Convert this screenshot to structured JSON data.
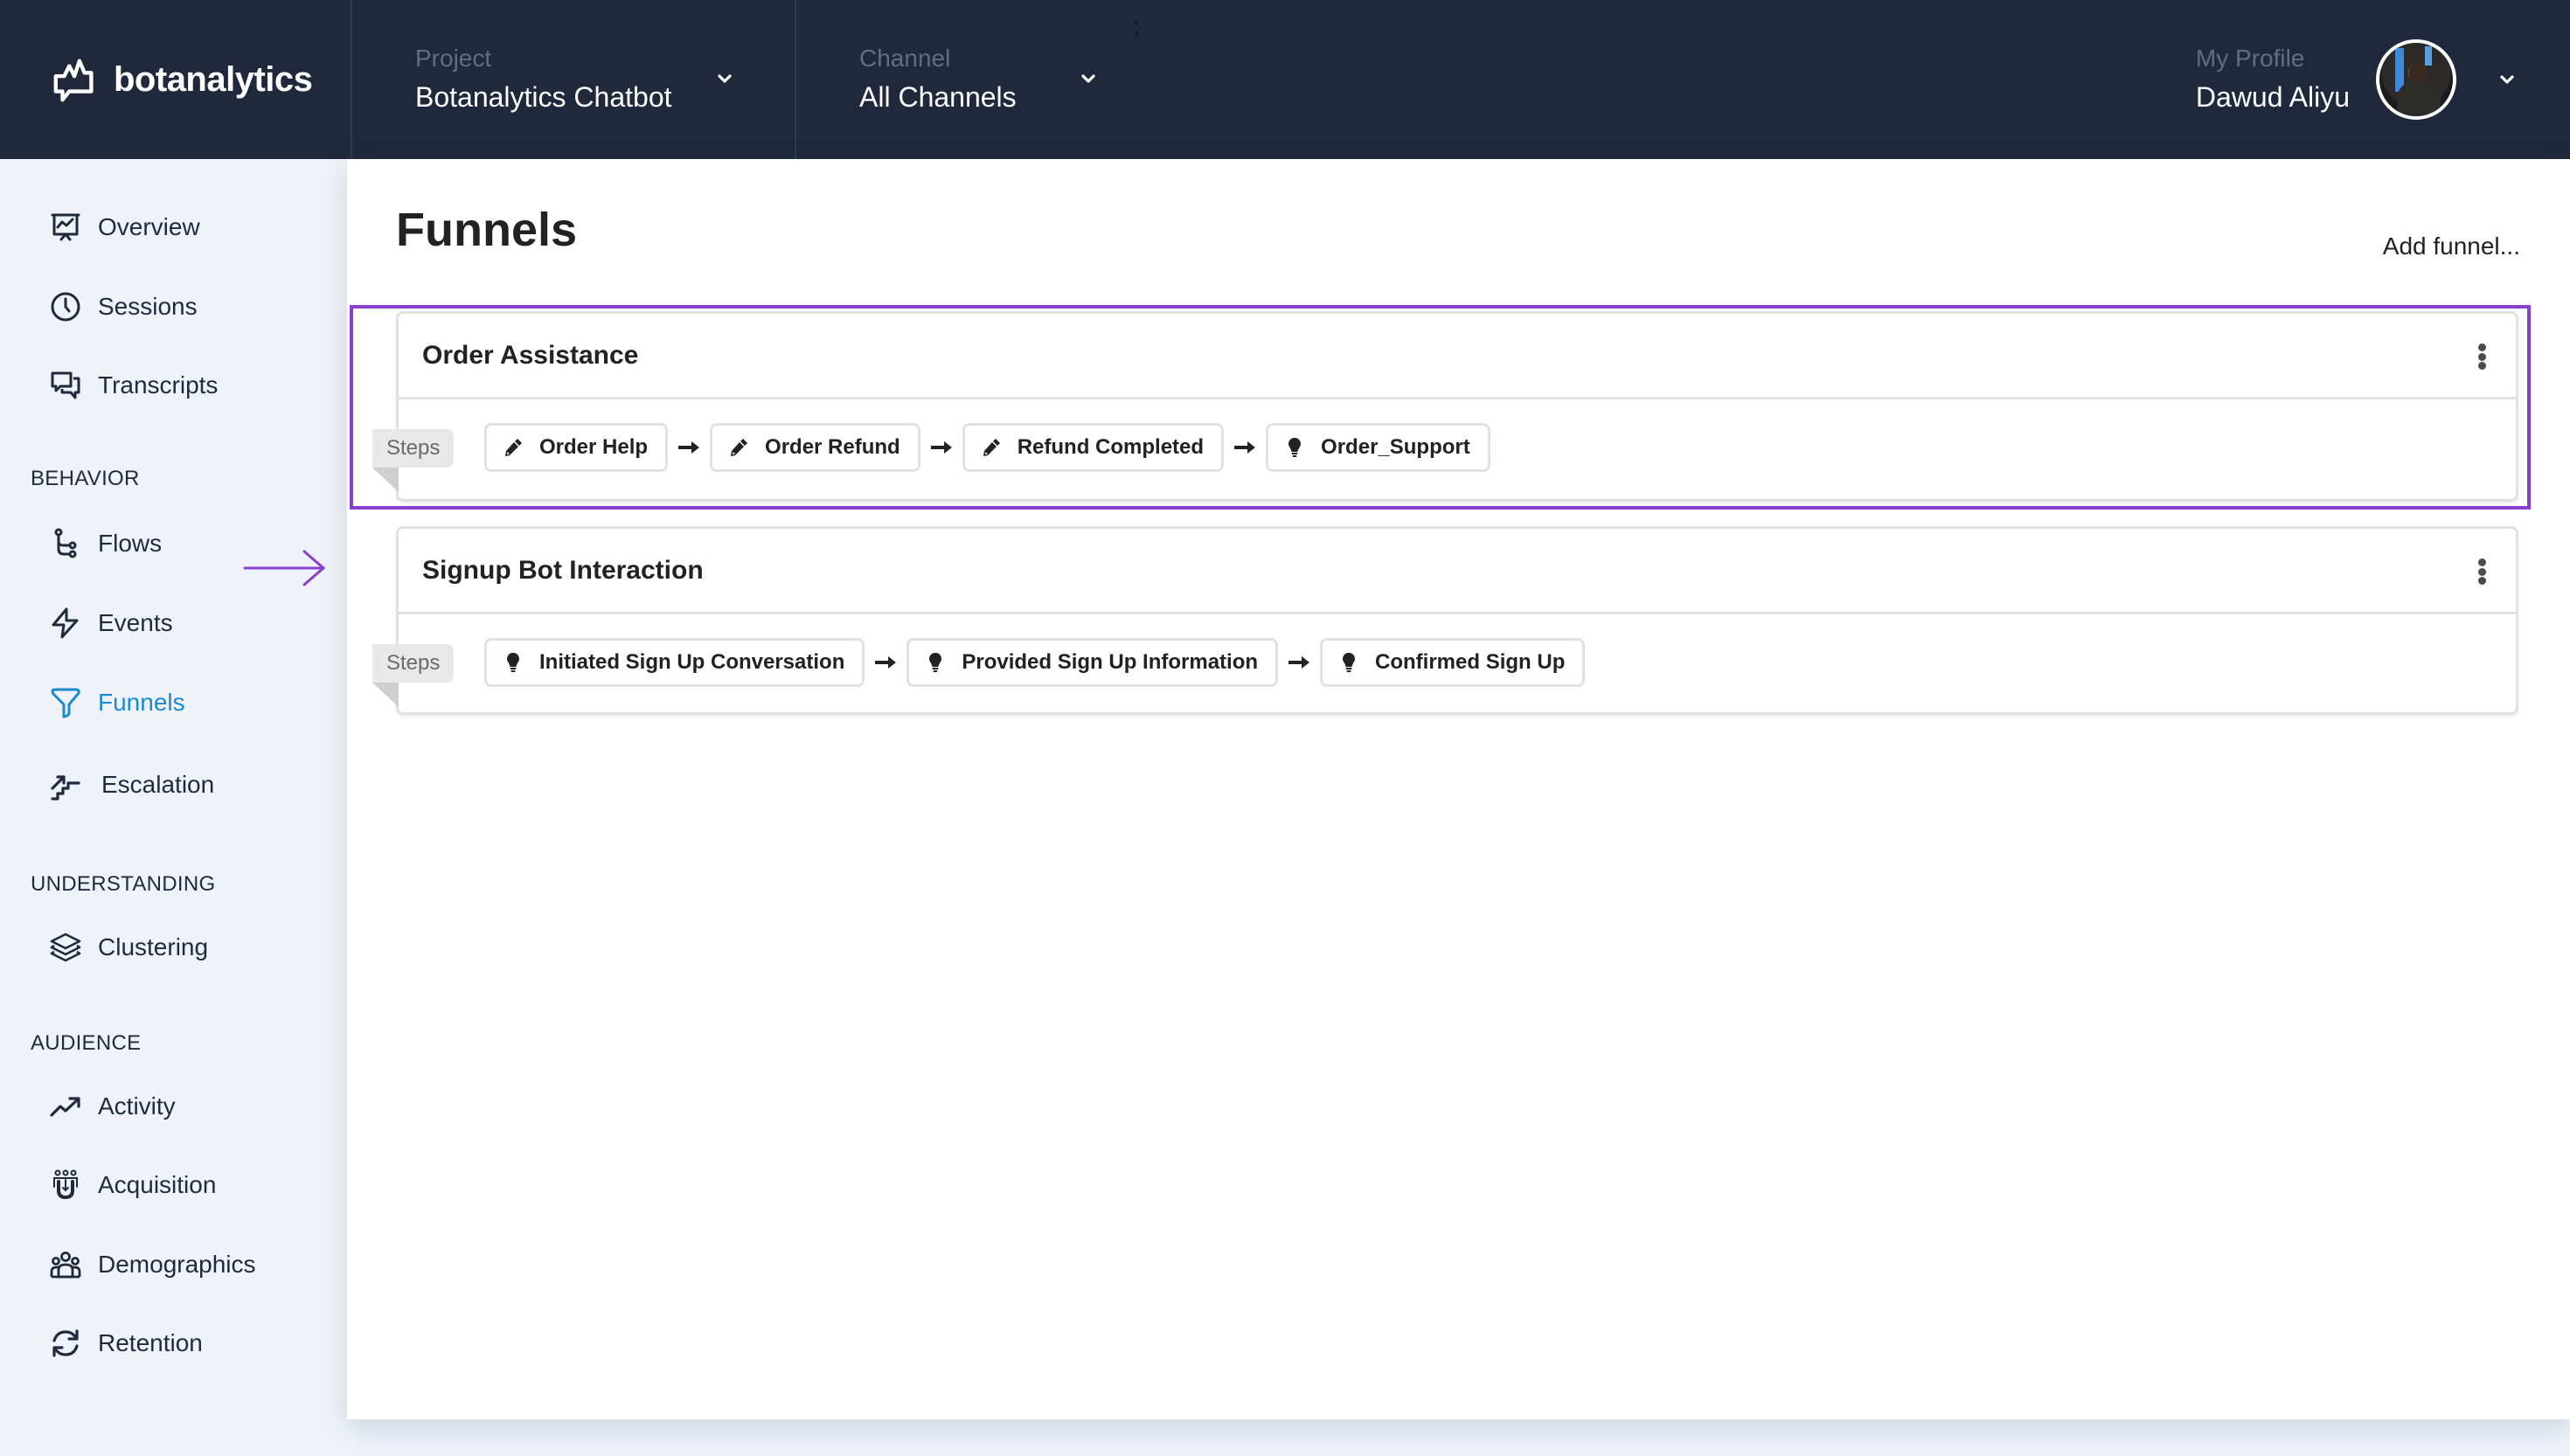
{
  "brand": {
    "name": "botanalytics",
    "icon": "chat-pulse-logo"
  },
  "header": {
    "project": {
      "label": "Project",
      "value": "Botanalytics Chatbot",
      "icon": "chevron-down-icon"
    },
    "channel": {
      "label": "Channel",
      "value": "All Channels",
      "icon": "chevron-down-icon"
    },
    "stray_mark": ";",
    "profile": {
      "label": "My Profile",
      "name": "Dawud Aliyu",
      "icon": "chevron-down-icon"
    }
  },
  "sidebar": {
    "items": [
      {
        "label": "Overview",
        "icon": "presentation-chart-icon",
        "active": false
      },
      {
        "label": "Sessions",
        "icon": "clock-icon",
        "active": false
      },
      {
        "label": "Transcripts",
        "icon": "chat-bubbles-icon",
        "active": false
      }
    ],
    "sections": [
      {
        "title": "BEHAVIOR",
        "items": [
          {
            "label": "Flows",
            "icon": "flow-branch-icon",
            "active": false
          },
          {
            "label": "Events",
            "icon": "lightning-icon",
            "active": false
          },
          {
            "label": "Funnels",
            "icon": "funnel-icon",
            "active": true
          },
          {
            "label": "Escalation",
            "icon": "stairs-arrow-icon",
            "active": false
          }
        ]
      },
      {
        "title": "UNDERSTANDING",
        "items": [
          {
            "label": "Clustering",
            "icon": "layers-icon",
            "active": false
          }
        ]
      },
      {
        "title": "AUDIENCE",
        "items": [
          {
            "label": "Activity",
            "icon": "trending-up-icon",
            "active": false
          },
          {
            "label": "Acquisition",
            "icon": "magnet-users-icon",
            "active": false
          },
          {
            "label": "Demographics",
            "icon": "users-group-icon",
            "active": false
          },
          {
            "label": "Retention",
            "icon": "refresh-icon",
            "active": false
          }
        ]
      }
    ]
  },
  "colors": {
    "header_bg": "#1f293b",
    "sidebar_bg": "#eff3f9",
    "active_nav": "#1a8ad1",
    "highlight": "#8a3fd1"
  },
  "main": {
    "title": "Funnels",
    "add_funnel_label": "Add funnel...",
    "steps_tag": "Steps",
    "funnels": [
      {
        "name": "Order Assistance",
        "highlighted": true,
        "steps": [
          {
            "label": "Order Help",
            "icon": "pencil-icon"
          },
          {
            "label": "Order Refund",
            "icon": "pencil-icon"
          },
          {
            "label": "Refund Completed",
            "icon": "pencil-icon"
          },
          {
            "label": "Order_Support",
            "icon": "lightbulb-icon"
          }
        ]
      },
      {
        "name": "Signup Bot Interaction",
        "highlighted": false,
        "steps": [
          {
            "label": "Initiated Sign Up Conversation",
            "icon": "lightbulb-icon"
          },
          {
            "label": "Provided Sign Up Information",
            "icon": "lightbulb-icon"
          },
          {
            "label": "Confirmed Sign Up",
            "icon": "lightbulb-icon"
          }
        ]
      }
    ]
  }
}
